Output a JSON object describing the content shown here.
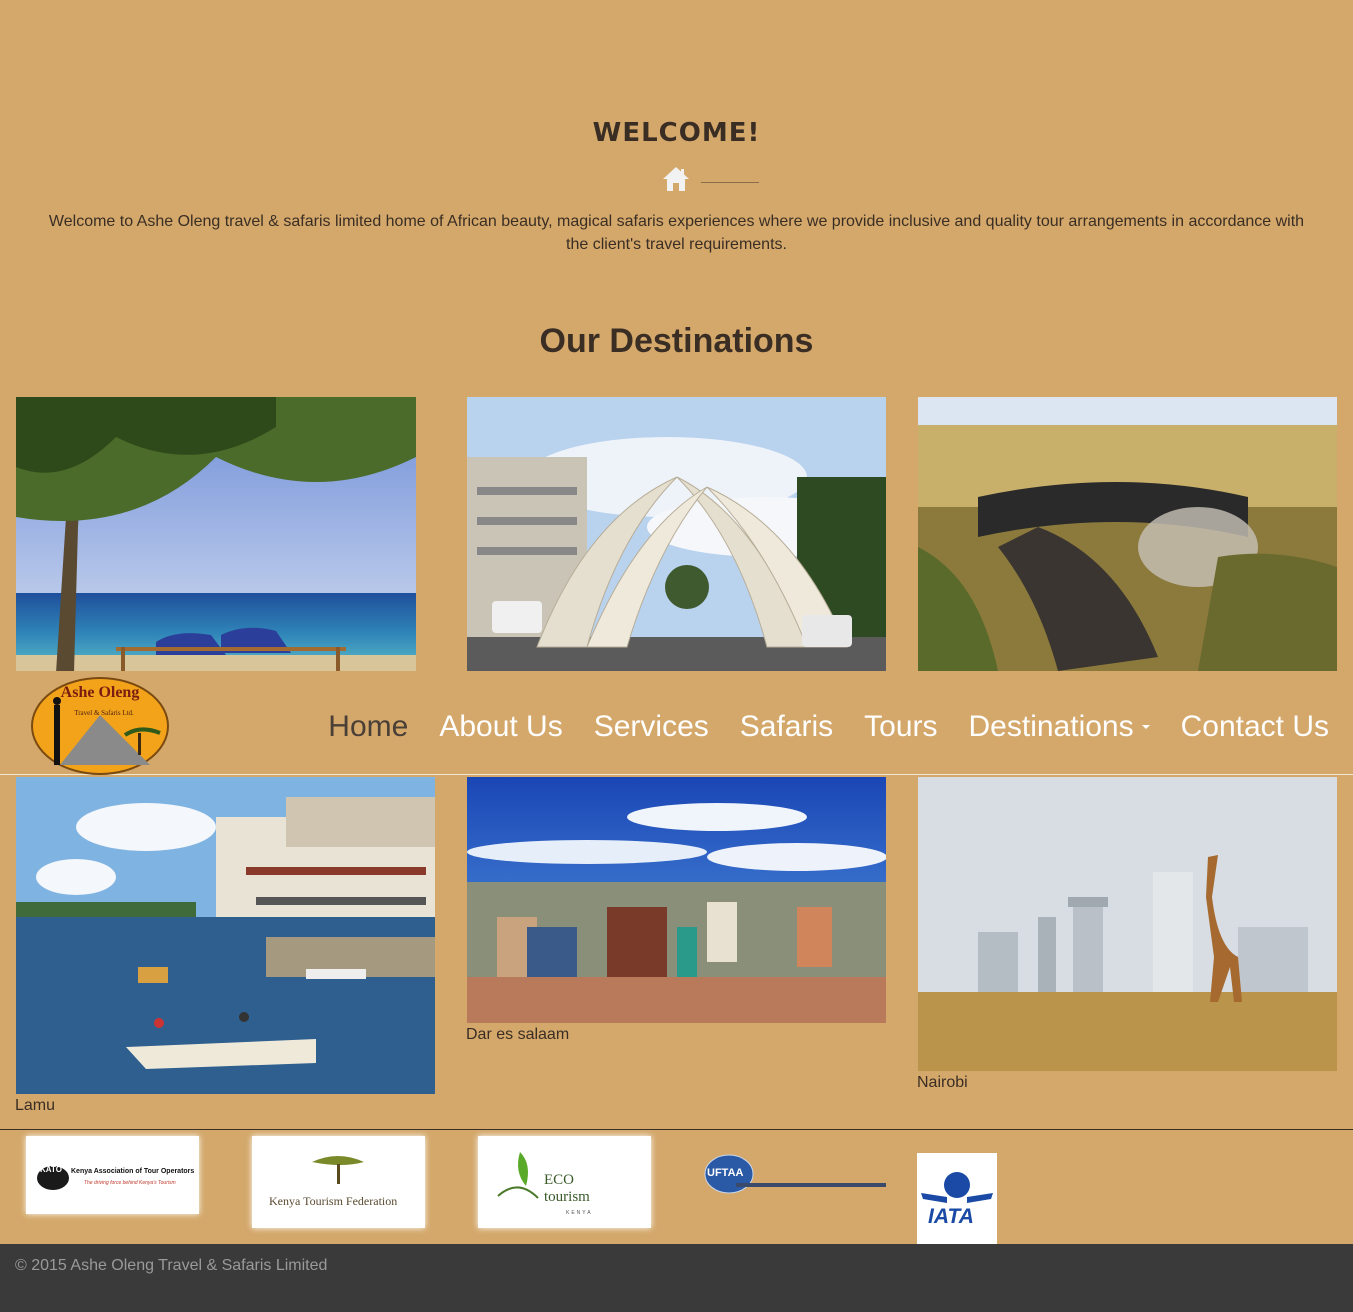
{
  "welcome": {
    "title": "WELCOME!",
    "text": "Welcome to Ashe Oleng travel & safaris limited home of African beauty, magical safaris experiences where we provide inclusive and quality tour arrangements in accordance with the client's travel requirements."
  },
  "destinations": {
    "title": "Our Destinations",
    "items": [
      {
        "caption": "",
        "scene": "beach"
      },
      {
        "caption": "",
        "scene": "mombasa-tusks"
      },
      {
        "caption": "",
        "scene": "migration"
      },
      {
        "caption": "Lamu",
        "scene": "lamu"
      },
      {
        "caption": "Dar es salaam",
        "scene": "city"
      },
      {
        "caption": "Nairobi",
        "scene": "giraffe"
      }
    ]
  },
  "navbar": {
    "logo_text": "Ashe Oleng",
    "logo_subtext": "Travel & Safaris Ltd.",
    "items": [
      {
        "label": "Home",
        "active": true
      },
      {
        "label": "About Us"
      },
      {
        "label": "Services"
      },
      {
        "label": "Safaris"
      },
      {
        "label": "Tours"
      },
      {
        "label": "Destinations",
        "dropdown": true
      },
      {
        "label": "Contact Us"
      }
    ]
  },
  "partners": [
    {
      "name": "KATO",
      "text": "Kenya Association of Tour Operators",
      "tagline": "The driving force behind Kenya's Tourism"
    },
    {
      "name": "Kenya Tourism Federation"
    },
    {
      "name": "ECO tourism",
      "sub": "KENYA"
    },
    {
      "name": "UFTAA"
    },
    {
      "name": "IATA"
    }
  ],
  "footer": {
    "copyright": "© 2015   Ashe Oleng Travel & Safaris Limited"
  },
  "colors": {
    "background": "#d4a86b",
    "footer": "#3a3a3a",
    "nav_text": "#ffffff",
    "active_nav": "#4a3f36"
  }
}
